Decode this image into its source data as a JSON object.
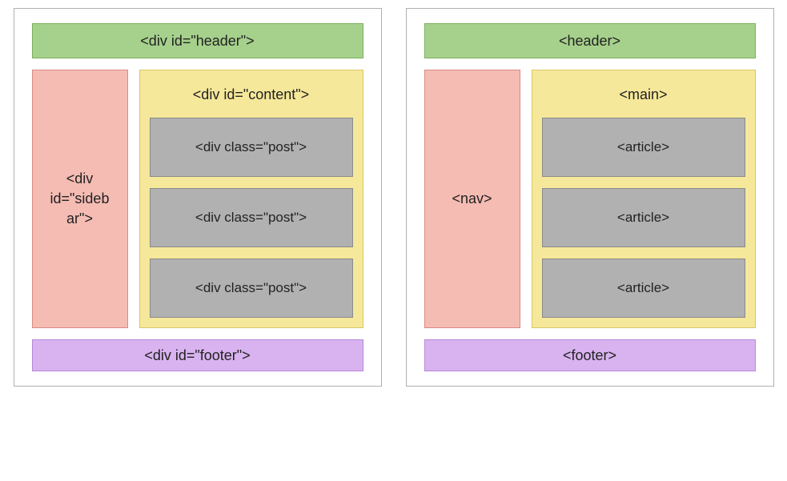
{
  "left": {
    "header": "<div id=\"header\">",
    "sidebar": "<div id=\"sideb ar\">",
    "content_label": "<div id=\"content\">",
    "posts": [
      "<div class=\"post\">",
      "<div class=\"post\">",
      "<div class=\"post\">"
    ],
    "footer": "<div id=\"footer\">"
  },
  "right": {
    "header": "<header>",
    "sidebar": "<nav>",
    "content_label": "<main>",
    "posts": [
      "<article>",
      "<article>",
      "<article>"
    ],
    "footer": "<footer>"
  },
  "colors": {
    "header_bg": "#a6d18c",
    "sidebar_bg": "#f5bcb4",
    "content_bg": "#f6e89a",
    "post_bg": "#b1b1b1",
    "footer_bg": "#d9b3f0"
  }
}
